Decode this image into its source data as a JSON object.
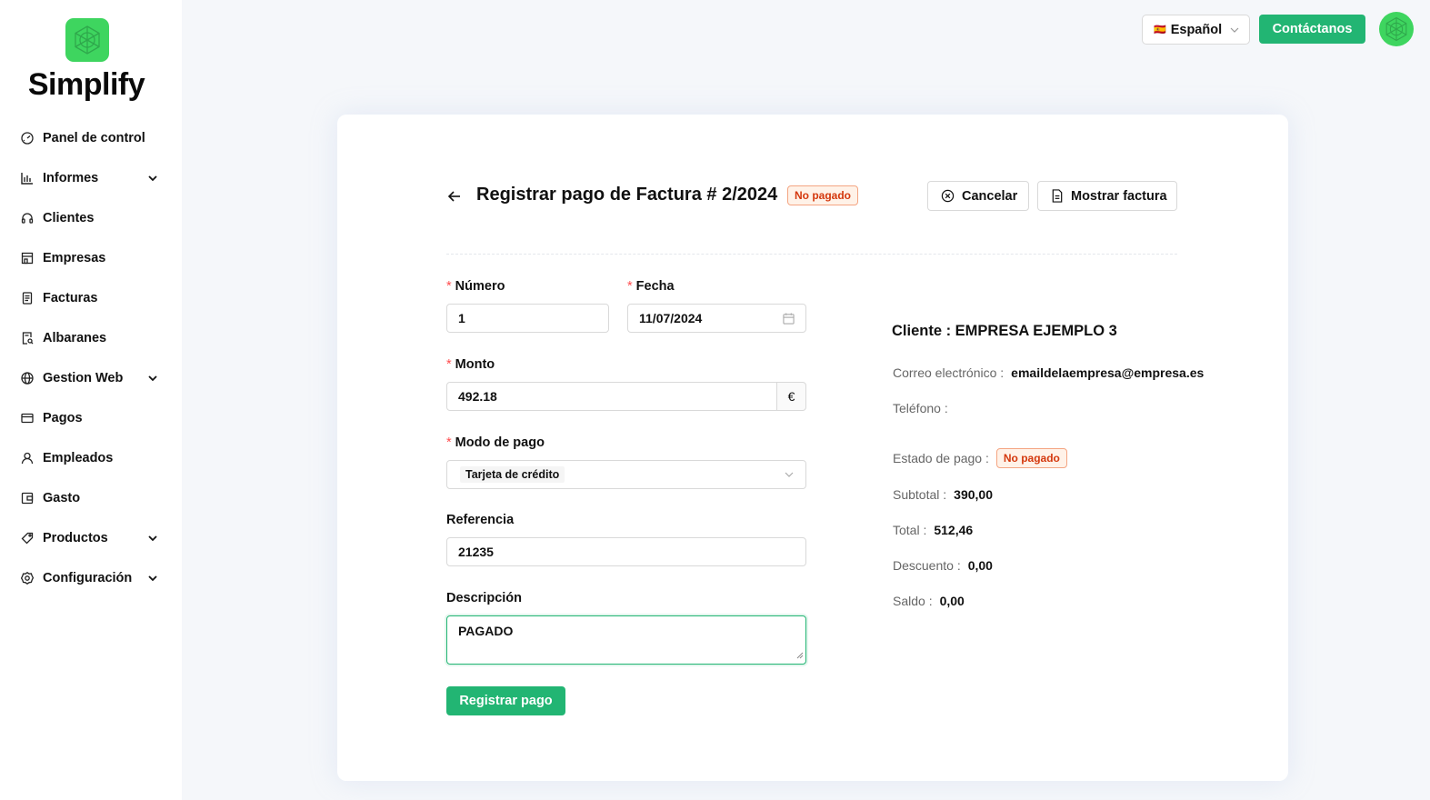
{
  "app": {
    "brand": "Simplify"
  },
  "sidebar": {
    "items": [
      {
        "label": "Panel de control",
        "icon": "dashboard-icon",
        "expandable": false
      },
      {
        "label": "Informes",
        "icon": "bar-chart-icon",
        "expandable": true
      },
      {
        "label": "Clientes",
        "icon": "headset-icon",
        "expandable": false
      },
      {
        "label": "Empresas",
        "icon": "shop-icon",
        "expandable": false
      },
      {
        "label": "Facturas",
        "icon": "file-text-icon",
        "expandable": false
      },
      {
        "label": "Albaranes",
        "icon": "file-search-icon",
        "expandable": false
      },
      {
        "label": "Gestion Web",
        "icon": "globe-icon",
        "expandable": true
      },
      {
        "label": "Pagos",
        "icon": "credit-card-icon",
        "expandable": false
      },
      {
        "label": "Empleados",
        "icon": "user-icon",
        "expandable": false
      },
      {
        "label": "Gasto",
        "icon": "wallet-icon",
        "expandable": false
      },
      {
        "label": "Productos",
        "icon": "tag-icon",
        "expandable": true
      },
      {
        "label": "Configuración",
        "icon": "settings-icon",
        "expandable": true
      }
    ]
  },
  "header": {
    "language": "Español",
    "contact_label": "Contáctanos"
  },
  "page": {
    "title": "Registrar pago de Factura # 2/2024",
    "status_badge": "No pagado",
    "cancel_label": "Cancelar",
    "show_invoice_label": "Mostrar factura"
  },
  "form": {
    "numero": {
      "label": "Número",
      "value": "1"
    },
    "fecha": {
      "label": "Fecha",
      "value": "11/07/2024"
    },
    "monto": {
      "label": "Monto",
      "value": "492.18",
      "currency": "€"
    },
    "modo_pago": {
      "label": "Modo de pago",
      "value": "Tarjeta de crédito"
    },
    "referencia": {
      "label": "Referencia",
      "value": "21235"
    },
    "descripcion": {
      "label": "Descripción",
      "value": "PAGADO"
    },
    "submit_label": "Registrar pago"
  },
  "summary": {
    "client": "Cliente : EMPRESA EJEMPLO 3",
    "email_label": "Correo electrónico :",
    "email": "emaildelaempresa@empresa.es",
    "phone_label": "Teléfono :",
    "phone": "",
    "payment_state_label": "Estado de pago :",
    "payment_state": "No pagado",
    "subtotal_label": "Subtotal :",
    "subtotal": "390,00",
    "total_label": "Total :",
    "total": "512,46",
    "discount_label": "Descuento :",
    "discount": "0,00",
    "balance_label": "Saldo :",
    "balance": "0,00"
  },
  "colors": {
    "accent": "#22b573",
    "logo": "#3ed55f",
    "danger": "#d4380d"
  }
}
